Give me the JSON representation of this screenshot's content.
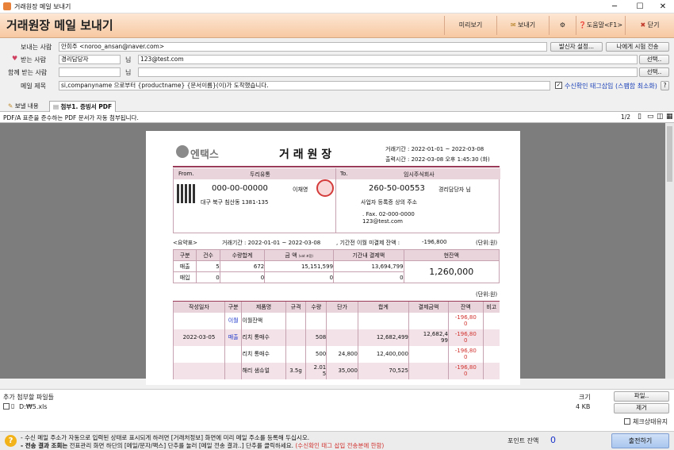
{
  "window": {
    "title": "거래원장 메일 보내기"
  },
  "header": {
    "title": "거래원장 메일 보내기",
    "preview": "미리보기",
    "send": "보내기",
    "help": "도움말<F1>",
    "close": "닫기"
  },
  "form": {
    "sender_label": "보내는 사람",
    "sender_value": "안희주 <noroo_ansan@naver.com>",
    "sender_settings": "발신자 설정...",
    "send_to_me": "나에게 시험 전송",
    "to_label": "받는 사람",
    "to_name": "경리담당자",
    "to_suffix": "님",
    "to_email": "123@test.com",
    "select": "선택..",
    "cc_label": "함께 받는 사람",
    "cc_suffix": "님",
    "cc_select": "선택..",
    "subject_label": "메일 제목",
    "subject_value": "si,companyname 으로부터 {productname} {문서이름}(이)가 도착했습니다.",
    "receipt_check": "수신확인 태그삽입 (스팸함 최소화)",
    "receipt_q": "?"
  },
  "tabs": {
    "content": "보낼 내용",
    "attach": "첨부1. 증빙서 PDF"
  },
  "viewer": {
    "notice": "PDF/A 표준을 준수하는 PDF 문서가 자동 첨부됩니다.",
    "page": "1/2"
  },
  "doc": {
    "logo": "엔택스",
    "title": "거 래 원 장",
    "period": "거래기간 : 2022-01-01 ~ 2022-03-08",
    "printed": "출력시간 : 2022-03-08 오후 1:45:30 (화)",
    "from_label": "From.",
    "from_company": "두리유통",
    "from_regno": "000-00-00000",
    "from_ceo": "이채영",
    "from_addr": "대구 북구 침산동 1381-135",
    "to_label": "To.",
    "to_company": "임시주식회사",
    "to_regno": "260-50-00553",
    "to_contact": "경리담당자 님",
    "to_addr": "사업자 등록증 상의 주소",
    "to_fax": ". Fax. 02-000-0000",
    "to_email": "123@test.com",
    "summary_label": "<요약표>",
    "summary_period": "거래기간 : 2022-01-01 ~ 2022-03-08",
    "summary_unpaid": ", 기간전 이월 미결제 잔액 :",
    "summary_unpaid_value": "-196,800",
    "unit": "(단위:원)",
    "sum_headers": [
      "구분",
      "건수",
      "수량합계",
      "금 액",
      "기간내 결제액",
      "현잔액"
    ],
    "amount_sub": "(vat 포함)",
    "sum_rows": [
      [
        "매출",
        "5",
        "672",
        "15,151,599",
        "13,694,799"
      ],
      [
        "매입",
        "0",
        "0",
        "0",
        "0"
      ]
    ],
    "balance": "1,260,000",
    "unit2": "(단위:원)",
    "det_headers": [
      "작성일자",
      "구분",
      "제품명",
      "규격",
      "수량",
      "단가",
      "합계",
      "결제금액",
      "잔액",
      "비고"
    ],
    "det_rows": [
      {
        "date": "",
        "type": "이월",
        "item": "이월잔액",
        "spec": "",
        "qty": "",
        "price": "",
        "total": "",
        "paid": "",
        "bal": "-196,80\n0",
        "note": "",
        "pink": false
      },
      {
        "date": "2022-03-05",
        "type": "매출",
        "item": "리치 통매수",
        "spec": "",
        "qty": "508",
        "price": "",
        "total": "12,682,499",
        "paid": "12,682,4\n99",
        "bal": "-196,80\n0",
        "note": "",
        "pink": true
      },
      {
        "date": "",
        "type": "",
        "item": "리치 통매수",
        "spec": "",
        "qty": "500",
        "price": "24,800",
        "total": "12,400,000",
        "paid": "",
        "bal": "-196,80\n0",
        "note": "",
        "pink": false
      },
      {
        "date": "",
        "type": "",
        "item": "해리 샘슈얼",
        "spec": "3.5g",
        "qty": "2.01\n5",
        "price": "35,000",
        "total": "70,525",
        "paid": "",
        "bal": "-196,80\n0",
        "note": "",
        "pink": true
      }
    ]
  },
  "attachments": {
    "title": "추가 첨부할 파일들",
    "size_label": "크기",
    "file": "D:₩5.xls",
    "file_size": "4 KB",
    "file_btn": "파일..",
    "remove_btn": "제거",
    "check_keep": "체크상태유지"
  },
  "footer": {
    "line1": "- 수신 메일 주소가 자동으로 입력된 상태로 표시되게 하려면 [거래처정보] 화면에 미리 메일 주소를 등록해 두십시오.",
    "line2a": "- 전송 결과 조회는",
    "line2b": " 전표관리 화면 하단의 [메일/문자/팩스] 단추를 눌러 [메일 전송 결과..] 단추를 클릭하세요.",
    "line2c": " (수신확인 태그 삽입 전송분에 한함)",
    "points_label": "포인트 잔액",
    "points": "0",
    "submit": "출전하기"
  }
}
